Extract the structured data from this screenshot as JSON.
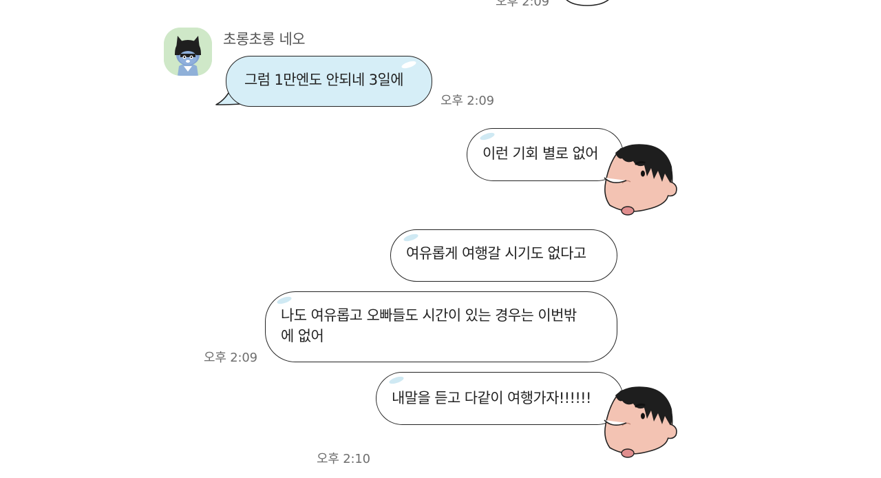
{
  "messages": [
    {
      "id": "m0",
      "time": "오후 2:09"
    },
    {
      "id": "m1",
      "sender": "초롱초롱 네오",
      "text": "그럼 1만엔도 안되네 3일에",
      "time": "오후 2:09"
    },
    {
      "id": "m2",
      "text": "이런 기회 별로 없어"
    },
    {
      "id": "m3",
      "text": "여유롭게 여행갈 시기도 없다고"
    },
    {
      "id": "m4",
      "line1": "나도 여유롭고 오빠들도 시간이 있는 경우는 이번밖",
      "line2": "에 없어",
      "time": "오후 2:09"
    },
    {
      "id": "m5",
      "text": "내말을 듣고 다같이 여행가자!!!!!!",
      "time": "오후 2:10"
    }
  ],
  "colors": {
    "incoming_bubble": "#d6eef7",
    "outgoing_bubble": "#ffffff",
    "neo_avatar_bg": "#cfe8c8",
    "shin_skin": "#f3c3b3",
    "timestamp": "#6e6e6e"
  },
  "icons": {
    "neo_avatar": "neo-cat-avatar-icon",
    "shin_avatar": "cartoon-boy-face-icon"
  }
}
